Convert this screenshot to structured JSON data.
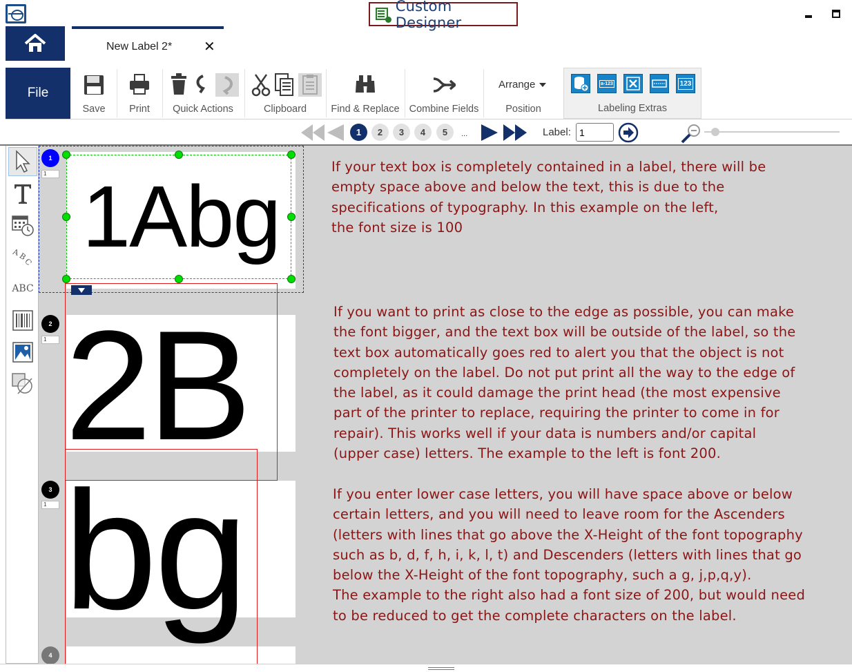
{
  "window": {
    "title": "Custom Designer"
  },
  "tabs": [
    {
      "label": "New Label 2*"
    }
  ],
  "ribbon": {
    "file": "File",
    "save": "Save",
    "print": "Print",
    "quick_actions": "Quick Actions",
    "clipboard": "Clipboard",
    "find_replace": "Find & Replace",
    "combine_fields": "Combine Fields",
    "arrange": "Arrange",
    "position": "Position",
    "labeling_extras": "Labeling Extras",
    "extras_icons": [
      "database-add-icon",
      "a-123",
      "delete-field-icon",
      "serial-field-icon",
      "123"
    ]
  },
  "navigation": {
    "pages": [
      "1",
      "2",
      "3",
      "4",
      "5"
    ],
    "active_page": "1",
    "ellipsis": "...",
    "label_caption": "Label:",
    "label_value": "1"
  },
  "canvas": {
    "labels": [
      {
        "number": "1",
        "qty": "1",
        "text": "1Abg",
        "font_size": "100",
        "badge_color": "#0000ff"
      },
      {
        "number": "2",
        "qty": "1",
        "text": "2B",
        "font_size": "200",
        "badge_color": "#000000"
      },
      {
        "number": "3",
        "qty": "1",
        "text": "bg",
        "font_size": "200",
        "badge_color": "#000000"
      },
      {
        "number": "4",
        "qty": "",
        "text": "",
        "badge_color": "#777777"
      }
    ]
  },
  "notes": {
    "note1": [
      "If your text box is completely contained in a label, there will be",
      "empty space above and below the text, this is due to the",
      "specifications of typography.  In this example on the left,",
      "the font size is 100"
    ],
    "note2": [
      "If you want to print as close to the edge as possible, you can make",
      "the font bigger, and the text box will be outside of the label, so the",
      "text box automatically goes red to alert you that the object is not",
      "completely on the label. Do not put print all the way to the edge of",
      "the label, as it could damage the print head (the most expensive",
      "part of the printer to replace, requiring the printer to come in for",
      "repair). This works well if your data is numbers and/or capital",
      "(upper case) letters.    The example to the left is font 200."
    ],
    "note3": [
      "If you enter lower case letters, you will have space above or below",
      "certain letters, and you will need to leave room for the Ascenders",
      "(letters with lines that go above the X-Height of the font topography",
      "such as b, d, f, h, i, k, l, t) and Descenders (letters with lines that go",
      "below the X-Height of the font topography, such a g, j,p,q,y).",
      "The example to the right also had a font size of 200, but would need",
      "to be reduced to get the complete characters on the label."
    ]
  },
  "colors": {
    "accent_navy": "#13306a",
    "note_text": "#8b1515",
    "selection_green": "#00dd00",
    "overflow_red": "#e01b1b"
  }
}
